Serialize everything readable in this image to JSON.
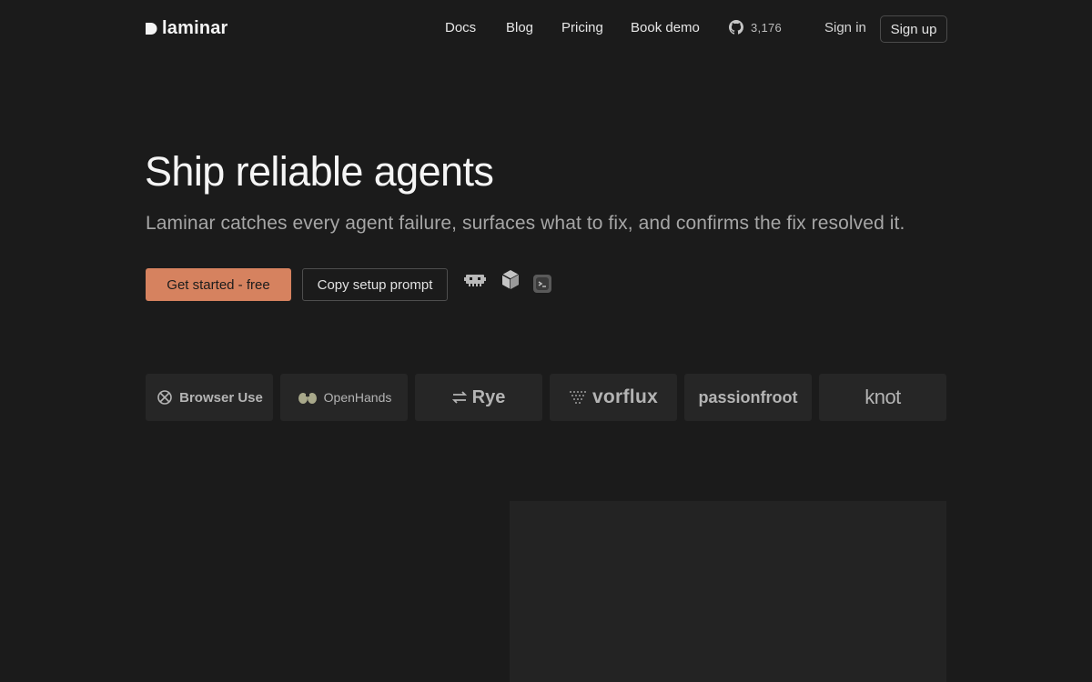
{
  "nav": {
    "logo_text": "laminar",
    "links": [
      "Docs",
      "Blog",
      "Pricing",
      "Book demo"
    ],
    "github_stars": "3,176",
    "sign_in": "Sign in",
    "sign_up": "Sign up"
  },
  "hero": {
    "title": "Ship reliable agents",
    "subtitle": "Laminar catches every agent failure, surfaces what to fix, and confirms the fix resolved it.",
    "cta_primary": "Get started - free",
    "cta_secondary": "Copy setup prompt",
    "tool_icons": [
      "agent-bot-icon",
      "cube-icon",
      "terminal-icon"
    ]
  },
  "customers": [
    "Browser Use",
    "OpenHands",
    "Rye",
    "vorflux",
    "passionfroot",
    "knot"
  ],
  "colors": {
    "background": "#1b1b1b",
    "accent": "#d6825f",
    "card": "#262626"
  }
}
